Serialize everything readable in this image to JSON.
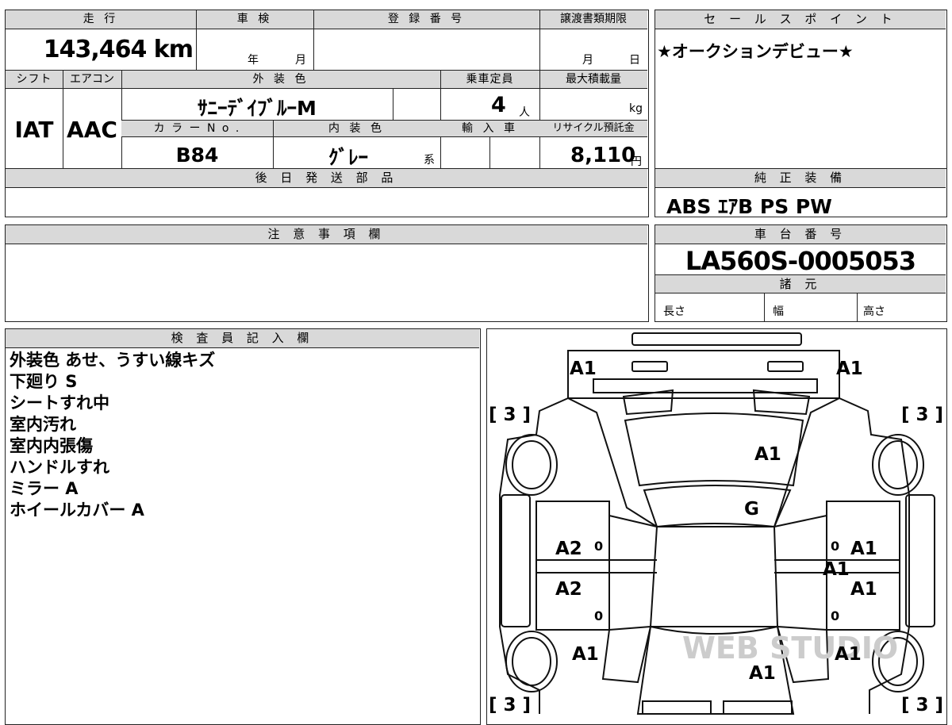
{
  "vehicle": {
    "labels": {
      "mileage": "走 行",
      "inspection": "車 検",
      "registration_no": "登 録 番 号",
      "transfer_deadline": "譲渡書類期限",
      "year": "年",
      "month": "月",
      "day": "日",
      "shift": "シフト",
      "aircon": "エアコン",
      "exterior_color": "外 装 色",
      "capacity": "乗車定員",
      "max_load": "最大積載量",
      "person_unit": "人",
      "kg_unit": "kg",
      "color_no": "カ ラ ー N o .",
      "interior_color": "内 装 色",
      "import": "輸 入 車",
      "recycle_fee": "リサイクル預託金",
      "yen_unit": "円",
      "kei_suffix": "系",
      "later_parts": "後 日 発 送 部 品"
    },
    "mileage": "143,464 km",
    "shift": "IAT",
    "aircon": "AAC",
    "exterior_color": "ｻﾆｰﾃﾞｲﾌﾞﾙｰM",
    "capacity": "4",
    "color_no": "B84",
    "interior_color": "ｸﾞﾚｰ",
    "recycle_fee": "8,110"
  },
  "sales_point": {
    "label": "セ ー ル ス ポ イ ン ト",
    "text": "★オークションデビュー★"
  },
  "equipment": {
    "label": "純 正 装 備",
    "text": "ABS ｴｱB PS PW"
  },
  "notes": {
    "label": "注 意 事 項 欄"
  },
  "chassis": {
    "label": "車 台 番 号",
    "number": "LA560S-0005053",
    "specs_label": "諸 元",
    "length": "長さ",
    "width": "幅",
    "height": "高さ"
  },
  "inspector": {
    "label": "検 査 員 記 入 欄",
    "lines": [
      "外装色 あせ、うすい線キズ",
      "下廻り S",
      "シートすれ中",
      "室内汚れ",
      "室内内張傷",
      "ハンドルすれ",
      "ミラー A",
      "ホイールカバー A"
    ]
  },
  "diagram": {
    "marks": {
      "front_left": "A1",
      "front_right": "A1",
      "windshield": "A1",
      "roof": "G",
      "left_front_door": "A2",
      "left_rear_door": "A2",
      "right_front_door": "A1",
      "right_middle": "A1",
      "right_rear_door": "A1",
      "left_rear_quarter": "A1",
      "right_rear_quarter": "A1",
      "rear": "A1",
      "tire_fl": "[ 3 ]",
      "tire_fr": "[ 3 ]",
      "tire_rl": "[ 3 ]",
      "tire_rr": "[ 3 ]",
      "zero": "0"
    },
    "watermark": "WEB STUDIO"
  }
}
